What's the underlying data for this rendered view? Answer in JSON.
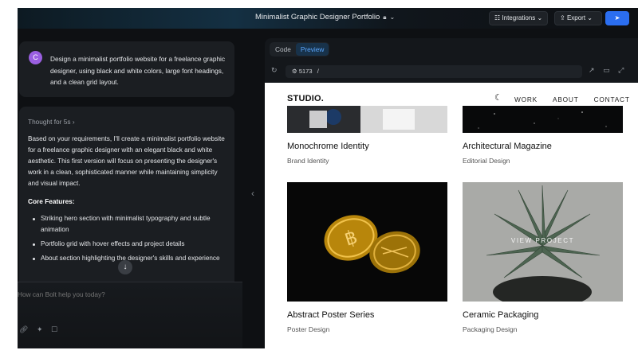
{
  "topbar": {
    "project_title": "Minimalist Graphic Designer Portfolio",
    "integrations_label": "Integrations",
    "export_label": "Export"
  },
  "chat": {
    "user_avatar_letter": "C",
    "user_message": "Design a minimalist portfolio website for a freelance graphic designer, using black and white colors, large font headings, and a clean grid layout.",
    "thought_label": "Thought for 5s",
    "ai_intro": "Based on your requirements, I'll create a minimalist portfolio website for a freelance graphic designer with an elegant black and white aesthetic. This first version will focus on presenting the designer's work in a clean, sophisticated manner while maintaining simplicity and visual impact.",
    "core_features_heading": "Core Features:",
    "features": [
      "Striking hero section with minimalist typography and subtle animation",
      "Portfolio grid with hover effects and project details",
      "About section highlighting the designer's skills and experience"
    ],
    "input_placeholder": "How can Bolt help you today?"
  },
  "preview": {
    "tabs": [
      {
        "label": "Code",
        "active": false
      },
      {
        "label": "Preview",
        "active": true
      }
    ],
    "port": "5173",
    "path": "/"
  },
  "site": {
    "logo": "STUDIO.",
    "nav": [
      "WORK",
      "ABOUT",
      "CONTACT"
    ],
    "projects": [
      {
        "title": "Monochrome Identity",
        "category": "Brand Identity"
      },
      {
        "title": "Architectural Magazine",
        "category": "Editorial Design"
      },
      {
        "title": "Abstract Poster Series",
        "category": "Poster Design"
      },
      {
        "title": "Ceramic Packaging",
        "category": "Packaging Design"
      }
    ],
    "hover_label": "VIEW PROJECT"
  },
  "colors": {
    "accent": "#2b6ef0",
    "avatar": "#9a5fe0",
    "active_tab_text": "#5aa7ff"
  }
}
